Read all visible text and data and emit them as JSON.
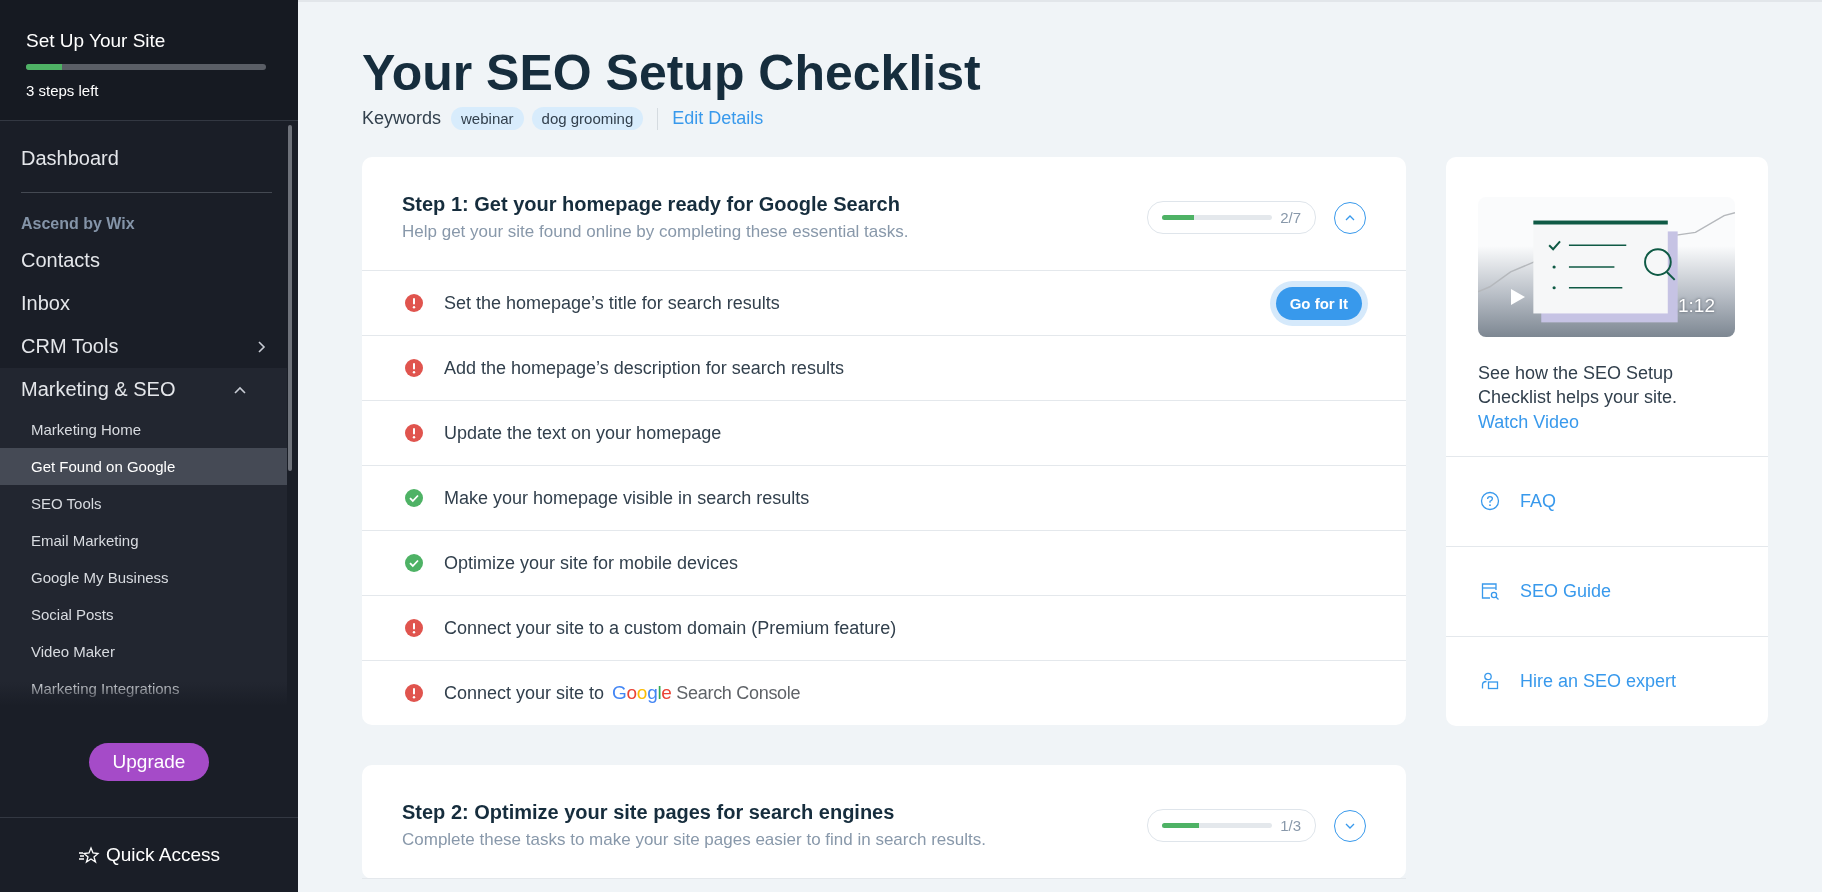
{
  "sidebar": {
    "setup": {
      "title": "Set Up Your Site",
      "level": 0.15,
      "steps_left": "3 steps left"
    },
    "nav": [
      {
        "kind": "item",
        "label": "Dashboard"
      },
      {
        "kind": "divider"
      },
      {
        "kind": "section",
        "label": "Ascend by Wix"
      },
      {
        "kind": "item",
        "label": "Contacts"
      },
      {
        "kind": "item",
        "label": "Inbox"
      },
      {
        "kind": "group",
        "label": "CRM Tools",
        "expanded": false
      },
      {
        "kind": "group",
        "label": "Marketing & SEO",
        "expanded": true,
        "children": [
          {
            "label": "Marketing Home",
            "selected": false
          },
          {
            "label": "Get Found on Google",
            "selected": true
          },
          {
            "label": "SEO Tools",
            "selected": false
          },
          {
            "label": "Email Marketing",
            "selected": false
          },
          {
            "label": "Google My Business",
            "selected": false
          },
          {
            "label": "Social Posts",
            "selected": false
          },
          {
            "label": "Video Maker",
            "selected": false
          },
          {
            "label": "Marketing Integrations",
            "selected": false
          }
        ]
      }
    ],
    "upgrade": "Upgrade",
    "quick_access": "Quick Access"
  },
  "page": {
    "title": "Your SEO Setup Checklist",
    "keywords_label": "Keywords",
    "keywords": [
      "webinar",
      "dog grooming"
    ],
    "edit": "Edit Details"
  },
  "steps": [
    {
      "title": "Step 1: Get your homepage ready for Google Search",
      "subtitle": "Help get your site found online by completing these essential tasks.",
      "level": 0.2857,
      "count": "2/7",
      "expanded": true,
      "tasks": [
        {
          "kind": "text",
          "text": "Set the homepage’s title for search results",
          "done": false,
          "button": "Go for It"
        },
        {
          "kind": "text",
          "text": "Add the homepage’s description for search results",
          "done": false
        },
        {
          "kind": "text",
          "text": "Update the text on your homepage",
          "done": false
        },
        {
          "kind": "text",
          "text": "Make your homepage visible in search results",
          "done": true
        },
        {
          "kind": "text",
          "text": "Optimize your site for mobile devices",
          "done": true
        },
        {
          "kind": "text",
          "text": "Connect your site to a custom domain (Premium feature)",
          "done": false
        },
        {
          "kind": "logo",
          "text": "Connect your site to",
          "logo": "Google",
          "logo_suffix": "Search Console",
          "done": false
        }
      ]
    },
    {
      "title": "Step 2: Optimize your site pages for search engines",
      "subtitle": "Complete these tasks to make your site pages easier to find in search results.",
      "level": 0.3333,
      "count": "1/3",
      "expanded": false
    }
  ],
  "aside": {
    "video": {
      "duration": "1:12"
    },
    "text": "See how the SEO Setup Checklist helps your site.",
    "link": "Watch Video",
    "links": [
      {
        "kind": "faq",
        "label": "FAQ"
      },
      {
        "kind": "guide",
        "label": "SEO Guide"
      },
      {
        "kind": "expert",
        "label": "Hire an SEO expert"
      }
    ]
  }
}
